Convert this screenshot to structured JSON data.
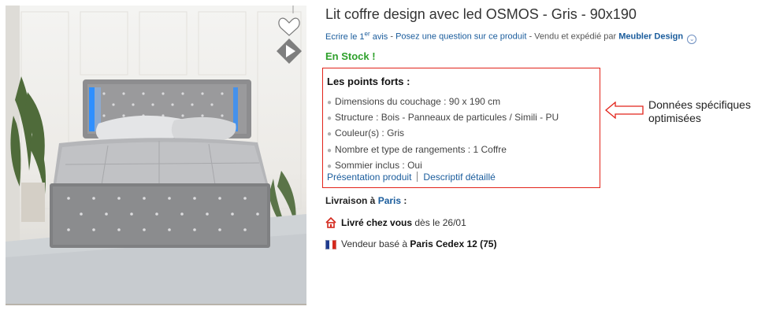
{
  "product": {
    "title": "Lit coffre design avec led OSMOS - Gris - 90x190",
    "review_prefix": "Ecrire le 1",
    "review_sup": "er",
    "review_suffix": " avis",
    "meta_sep": " - ",
    "ask_question": "Posez une question sur ce produit",
    "sold_by_label": "Vendu et expédié par ",
    "seller": "Meubler Design",
    "stock": "En Stock !"
  },
  "points_forts": {
    "title": "Les points forts :",
    "items": [
      "Dimensions du couchage : 90 x 190 cm",
      "Structure : Bois - Panneaux de particules / Simili - PU",
      "Couleur(s) : Gris",
      "Nombre et type de rangements : 1 Coffre",
      "Sommier inclus : Oui"
    ],
    "link_presentation": "Présentation produit",
    "link_descriptif": "Descriptif détaillé"
  },
  "annotation": {
    "line1": "Données spécifiques",
    "line2": "optimisées"
  },
  "delivery": {
    "label": "Livraison à ",
    "city": "Paris",
    "colon": " :",
    "home_bold": "Livré chez vous",
    "home_rest": " dès le 26/01",
    "seller_location_prefix": "Vendeur basé à ",
    "seller_location": "Paris Cedex 12 (75)"
  },
  "colors": {
    "link": "#1a5c9c",
    "stock_green": "#2ea02b",
    "highlight_red": "#e2231a"
  },
  "icons": [
    "heart-icon",
    "play-video-icon",
    "home-icon",
    "french-flag-icon",
    "chevron-down-icon"
  ]
}
